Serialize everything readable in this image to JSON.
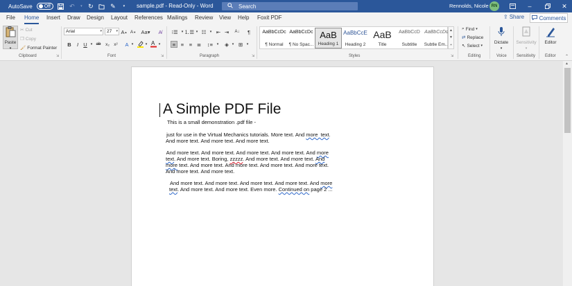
{
  "titlebar": {
    "autosave_label": "AutoSave",
    "autosave_state": "Off",
    "doc_title": "sample.pdf  -  Read-Only  -  Word",
    "search_placeholder": "Search",
    "user_name": "Rennolds, Nicole P.",
    "user_initials": "RN"
  },
  "tabs": [
    {
      "label": "File"
    },
    {
      "label": "Home"
    },
    {
      "label": "Insert"
    },
    {
      "label": "Draw"
    },
    {
      "label": "Design"
    },
    {
      "label": "Layout"
    },
    {
      "label": "References"
    },
    {
      "label": "Mailings"
    },
    {
      "label": "Review"
    },
    {
      "label": "View"
    },
    {
      "label": "Help"
    },
    {
      "label": "Foxit PDF"
    }
  ],
  "share_label": "Share",
  "comments_label": "Comments",
  "clipboard": {
    "paste": "Paste",
    "cut": "Cut",
    "copy": "Copy",
    "format_painter": "Format Painter",
    "label": "Clipboard"
  },
  "font": {
    "name": "Arial",
    "size": "27",
    "label": "Font"
  },
  "paragraph": {
    "label": "Paragraph"
  },
  "styles": {
    "label": "Styles",
    "items": [
      {
        "sample": "AaBbCcDc",
        "name": "¶ Normal"
      },
      {
        "sample": "AaBbCcDc",
        "name": "¶ No Spac..."
      },
      {
        "sample": "AaB",
        "name": "Heading 1"
      },
      {
        "sample": "AaBbCcE",
        "name": "Heading 2"
      },
      {
        "sample": "AaB",
        "name": "Title"
      },
      {
        "sample": "AaBbCcD",
        "name": "Subtitle"
      },
      {
        "sample": "AaBbCcDd",
        "name": "Subtle Em..."
      }
    ]
  },
  "editing": {
    "find": "Find",
    "replace": "Replace",
    "select": "Select",
    "label": "Editing"
  },
  "voice": {
    "dictate": "Dictate",
    "label": "Voice"
  },
  "sensitivity": {
    "button": "Sensitivity",
    "label": "Sensitivity"
  },
  "editor": {
    "button": "Editor",
    "label": "Editor"
  },
  "document": {
    "title": "A Simple PDF File",
    "line1": "This is a small demonstration .pdf file -",
    "p2_l1a": " just for use in the Virtual Mechanics tutorials. More text. And ",
    "p2_l1b": "more  text",
    "p2_l1c": ".",
    "p2_l2": "And more text. And more text. And more text.",
    "p3_l1a": " And more text. And more text. And more text. And more text. And ",
    "p3_l1b": "more",
    "p3_l2a": "text",
    "p3_l2b": ". And more text. Boring, ",
    "p3_l2c": "zzzzz",
    "p3_l2d": ". And more text. And more text. ",
    "p3_l2e": "And",
    "p3_l3a": "more",
    "p3_l3b": " text. And more text. And more text. And more text. And more text.",
    "p3_l4": "And more text. And more text.",
    "p4_l1a": "And more text. And more text. And more text. And more text. And ",
    "p4_l1b": "more",
    "p4_l2a": "text",
    "p4_l2b": ". And more text. And more text. Even more. ",
    "p4_l2c": "Continued on",
    "p4_l2d": " page 2 ..."
  }
}
